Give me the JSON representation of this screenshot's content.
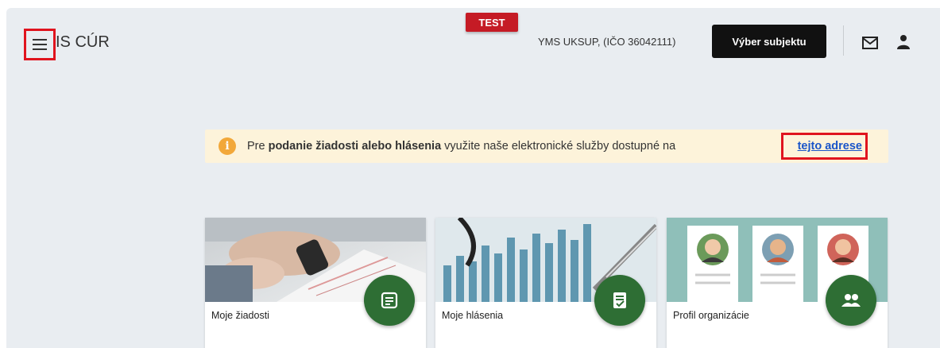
{
  "header": {
    "app_title": "IS CÚR",
    "env_badge": "TEST",
    "subject": "YMS UKSUP, (IČO 36042111)",
    "select_subject_label": "Výber subjektu",
    "icons": [
      "menu-icon",
      "mail-icon",
      "user-icon"
    ]
  },
  "banner": {
    "text_before": "Pre ",
    "text_bold": "podanie žiadosti alebo hlásenia",
    "text_after": " využite naše elektronické služby dostupné na ",
    "link": "tejto adrese",
    "icon": "info-icon"
  },
  "cards": [
    {
      "label": "Moje žiadosti",
      "icon": "document-icon"
    },
    {
      "label": "Moje hlásenia",
      "icon": "checklist-icon"
    },
    {
      "label": "Profil organizácie",
      "icon": "group-icon"
    }
  ],
  "colors": {
    "accent_green": "#2e6e34",
    "badge_red": "#c51b25",
    "link_blue": "#1a55c9",
    "banner_bg": "#fdf3da",
    "highlight_red": "#e0141e"
  }
}
